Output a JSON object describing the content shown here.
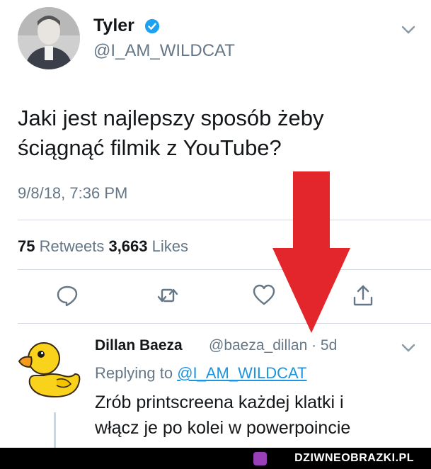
{
  "tweet": {
    "author_name": "Tyler",
    "handle": "@I_AM_WILDCAT",
    "text_line1": "Jaki jest najlepszy sposób żeby",
    "text_line2": "ściągnąć filmik z YouTube?",
    "timestamp": "9/8/18, 7:36 PM",
    "retweets_count": "75",
    "retweets_label": "Retweets",
    "likes_count": "3,663",
    "likes_label": "Likes"
  },
  "reply": {
    "author_name": "Dillan Baeza",
    "handle_and_time": "@baeza_dillan · 5d",
    "replying_prefix": "Replying to",
    "replying_to": "@I_AM_WILDCAT",
    "text_line1": "Zrób printscreena każdej klatki i",
    "text_line2": "włącz je po kolei w powerpoincie"
  },
  "watermark": "DZIWNEOBRAZKI.PL",
  "icons": {
    "verified": "verified-badge-icon",
    "menu": "chevron-down-icon",
    "reply": "reply-icon",
    "retweet": "retweet-icon",
    "like": "heart-icon",
    "share": "share-icon"
  },
  "colors": {
    "text": "#14171a",
    "secondary": "#657786",
    "link": "#1b95e0",
    "verified": "#1da1f2",
    "arrow": "#e3262b"
  }
}
